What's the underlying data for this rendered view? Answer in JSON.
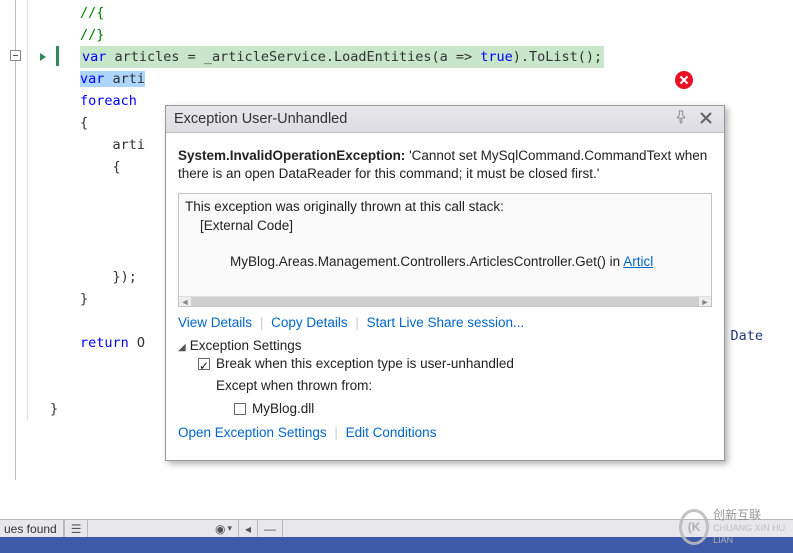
{
  "code": {
    "l1": "//{",
    "l2": "",
    "l3": "//}",
    "l4_a": "var",
    "l4_b": " articles = _articleService.LoadEntities(a => ",
    "l4_c": "true",
    "l4_d": ").ToList();",
    "l5": "",
    "l6a": "var",
    "l6b": " arti",
    "l7": "",
    "l8": "foreach",
    "l9": "{",
    "l10": "    arti",
    "l11": "    {",
    "l15": "    });",
    "l16": "}",
    "l18a": "return",
    "l18b": " O",
    "l22": "}",
    "float_date": "Date"
  },
  "popup": {
    "title": "Exception User-Unhandled",
    "msg_b": "System.InvalidOperationException:",
    "msg_rest": " 'Cannot set MySqlCommand.CommandText when there is an open DataReader for this command; it must be closed first.'",
    "stack_l1": "This exception was originally thrown at this call stack:",
    "stack_l2": "    [External Code]",
    "stack_l3a": "    MyBlog.Areas.Management.Controllers.ArticlesController.Get() in ",
    "stack_l3b": "Articl",
    "link_view": "View Details",
    "link_copy": "Copy Details",
    "link_share": "Start Live Share session...",
    "settings_title": "Exception Settings",
    "opt_break": "Break when this exception type is user-unhandled",
    "opt_except": "Except when thrown from:",
    "opt_dll": "MyBlog.dll",
    "link_open": "Open Exception Settings",
    "link_edit": "Edit Conditions"
  },
  "status": {
    "issues": "ues found",
    "glyph1": "☰",
    "glyph2": "◉",
    "glyph3": "▾",
    "glyph4": "◂",
    "glyph5": "—"
  },
  "watermark": {
    "circle": "(K",
    "main": "创新互联",
    "sub": "CHUANG XIN HU LIAN"
  }
}
